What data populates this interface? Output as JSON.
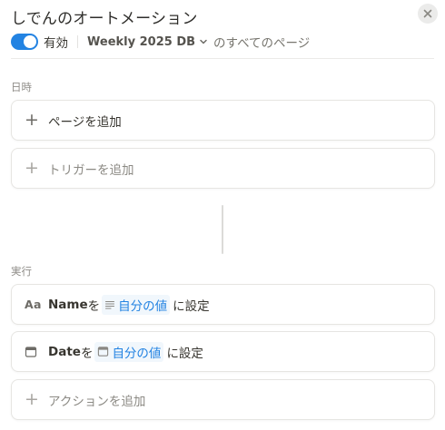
{
  "header": {
    "title": "しでんのオートメーション",
    "toggle_label": "有効",
    "database_name": "Weekly 2025 DB",
    "scope_suffix": "のすべてのページ"
  },
  "trigger_section": {
    "label": "日時",
    "add_page_label": "ページを追加",
    "add_trigger_label": "トリガーを追加"
  },
  "action_section": {
    "label": "実行",
    "actions": [
      {
        "icon": "Aa",
        "property": "Name",
        "particle": "を",
        "value": "自分の値",
        "suffix": "に設定"
      },
      {
        "property": "Date",
        "particle": "を",
        "value": "自分の値",
        "suffix": "に設定"
      }
    ],
    "add_action_label": "アクションを追加"
  },
  "colors": {
    "accent": "#2383e2",
    "toggle_on": "#2383e2",
    "border": "#e6e5e2"
  },
  "icons": {
    "close": "close-icon",
    "chevron": "chevron-down-icon",
    "plus": "plus-icon",
    "text_property": "text-property-icon",
    "date_property": "calendar-icon",
    "lines": "text-lines-icon"
  }
}
